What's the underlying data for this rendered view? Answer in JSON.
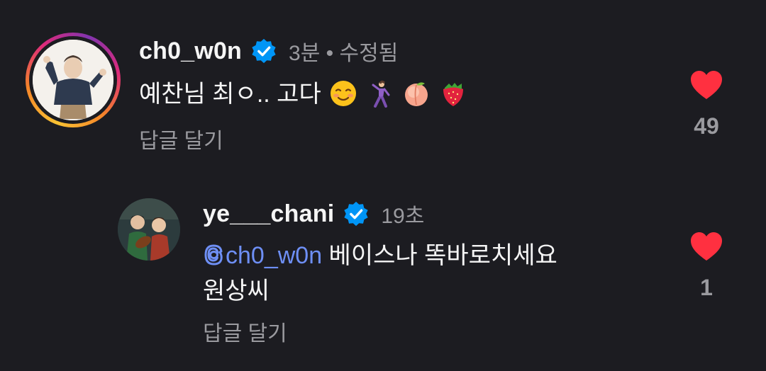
{
  "comments": [
    {
      "username": "ch0_w0n",
      "verified": true,
      "meta": "3분 • 수정됨",
      "text": "예찬님 최ㅇ.. 고다",
      "emojis": [
        "relieved-smile-emoji",
        "dancing-person-emoji",
        "peach-emoji",
        "strawberry-emoji"
      ],
      "reply_label": "답글 달기",
      "like_count": "49",
      "liked": true
    },
    {
      "username": "ye___chani",
      "verified": true,
      "meta": "19초",
      "mention": "ch0_w0n",
      "text_line1": " 베이스나 똑바로치세요",
      "text_line2": "원상씨",
      "reply_label": "답글 달기",
      "like_count": "1",
      "liked": true
    }
  ],
  "colors": {
    "background": "#1c1c21",
    "like_red": "#ff3040",
    "verified_blue": "#0095f6",
    "mention_blue": "#6e8ff5",
    "secondary_text": "#9a9a9f"
  }
}
